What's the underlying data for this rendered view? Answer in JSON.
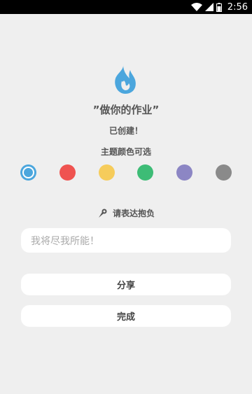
{
  "status_bar": {
    "time": "2:56",
    "icons": [
      "wifi-icon",
      "signal-icon",
      "battery-icon"
    ]
  },
  "app_icon": "flame-icon",
  "title": "”做你的作业”",
  "created_label": "已创建！",
  "theme": {
    "label": "主题颜色可选",
    "colors": [
      {
        "name": "blue",
        "hex": "#4ba6dd",
        "selected": true
      },
      {
        "name": "red",
        "hex": "#ef5350"
      },
      {
        "name": "yellow",
        "hex": "#f6cc5b"
      },
      {
        "name": "green",
        "hex": "#3dbc76"
      },
      {
        "name": "purple",
        "hex": "#8c86c4"
      },
      {
        "name": "gray",
        "hex": "#8a8a8a"
      }
    ]
  },
  "aspiration": {
    "icon": "megaphone-icon",
    "label": "请表达抱负",
    "placeholder": "我将尽我所能！"
  },
  "buttons": {
    "share": "分享",
    "done": "完成"
  }
}
